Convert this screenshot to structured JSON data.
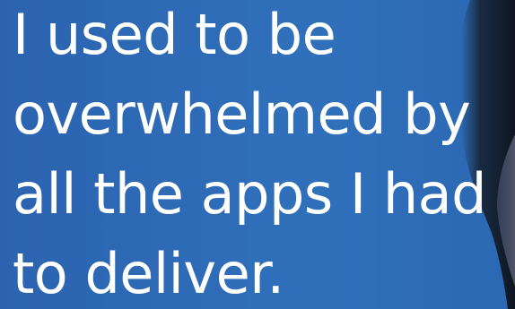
{
  "hero": {
    "background_color": "#2f6ab5",
    "text_color": "#ffffff",
    "headline_lines": [
      "I used to be",
      "overwhelmed by",
      "all the apps I had",
      "to deliver."
    ]
  }
}
